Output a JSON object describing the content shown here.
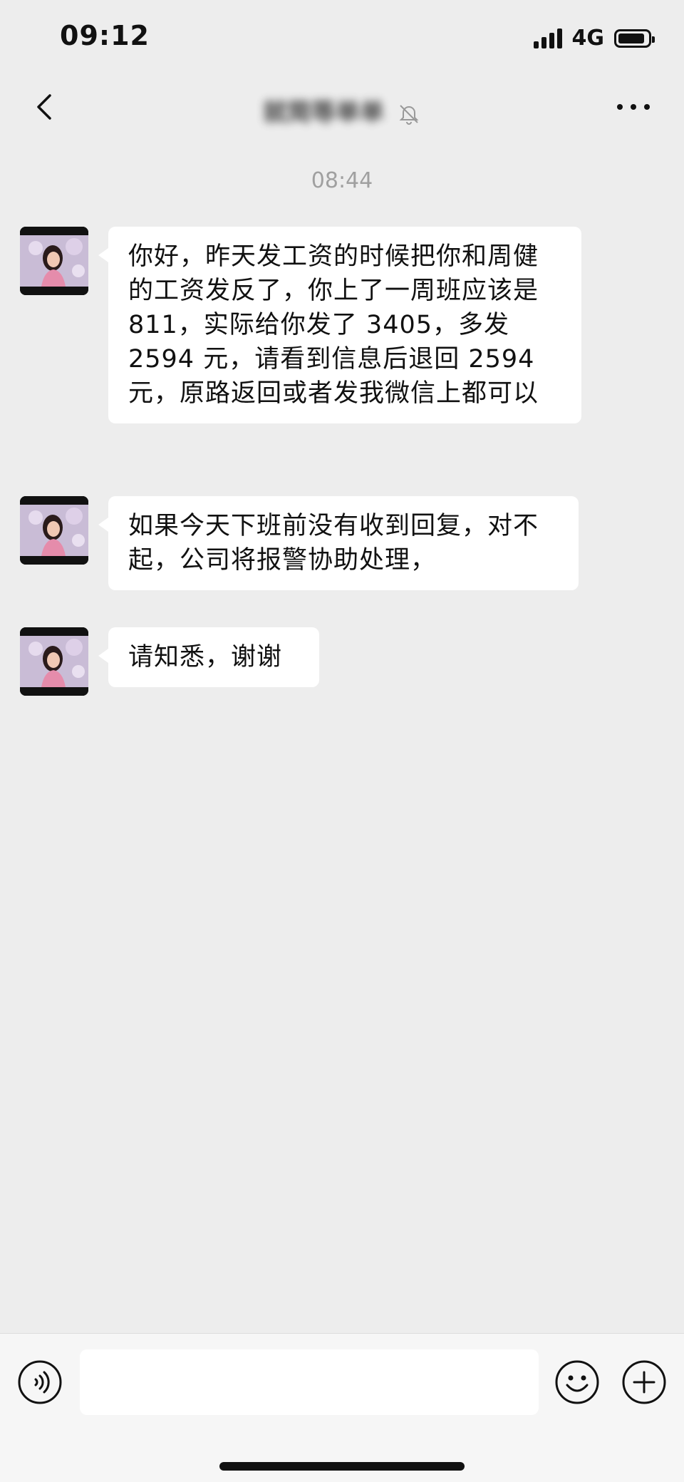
{
  "status_bar": {
    "time": "09:12",
    "network": "4G",
    "battery_level": 0.9
  },
  "nav": {
    "title": "就简等单单"
  },
  "chat": {
    "timestamp": "08:44",
    "messages": [
      {
        "text": "你好，昨天发工资的时候把你和周健的工资发反了，你上了一周班应该是 811，实际给你发了 3405，多发 2594 元，请看到信息后退回 2594 元，原路返回或者发我微信上都可以"
      },
      {
        "text": "如果今天下班前没有收到回复，对不起，公司将报警协助处理，"
      },
      {
        "text": "请知悉，谢谢"
      }
    ]
  },
  "input_bar": {
    "message_value": ""
  },
  "colors": {
    "background": "#ededed",
    "bubble": "#ffffff",
    "timestamp": "#a0a0a0"
  }
}
